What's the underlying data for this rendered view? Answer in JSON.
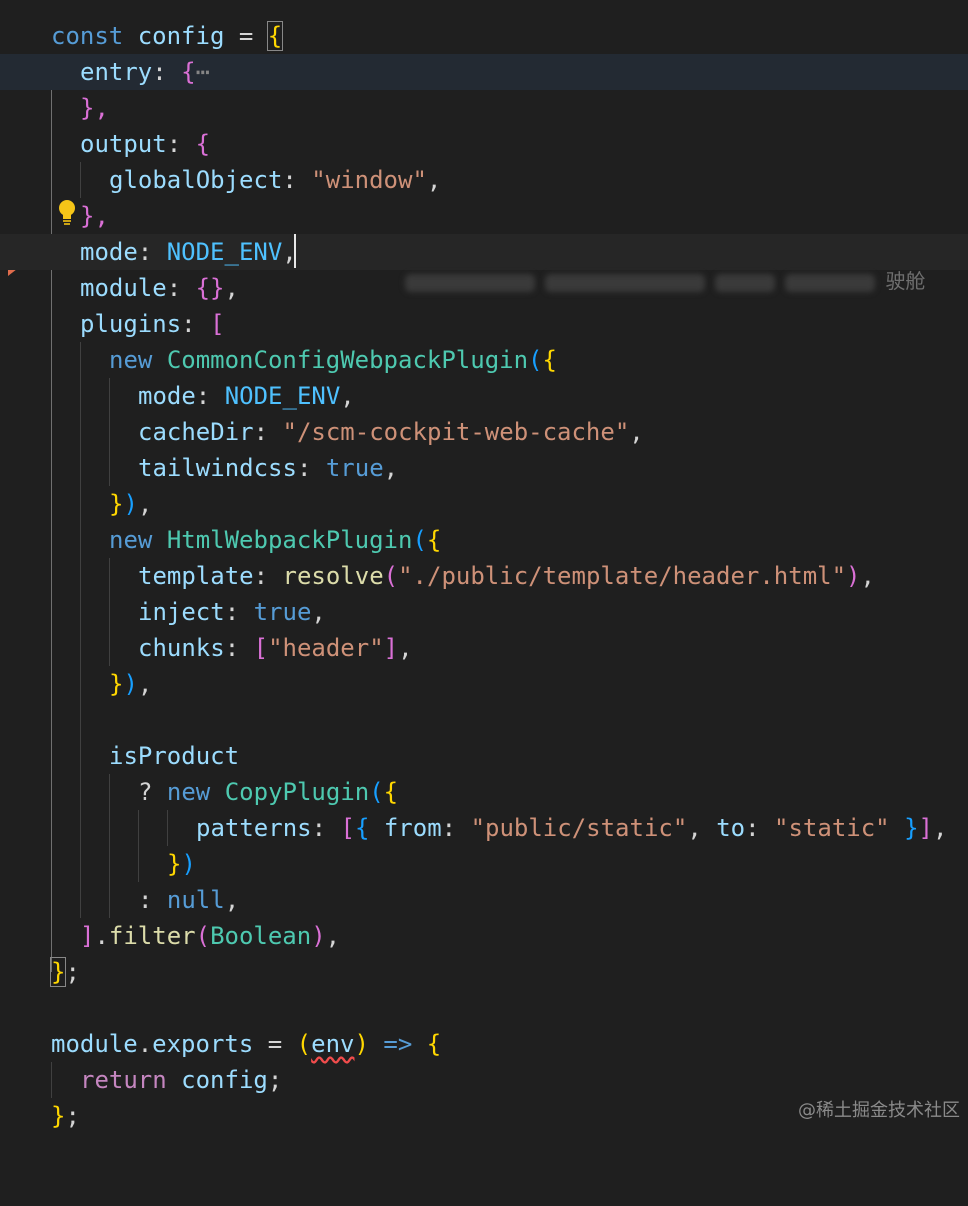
{
  "editor": {
    "lines": {
      "l1": {
        "kw": "const",
        "var": "config",
        "op": "=",
        "brace": "{"
      },
      "l2": {
        "key": "entry",
        "colon": ":",
        "brace": "{",
        "fold": "⋯"
      },
      "l3": {
        "text": "},"
      },
      "l4": {
        "key": "output",
        "colon": ":",
        "brace": "{"
      },
      "l5": {
        "key": "globalObject",
        "colon": ":",
        "str": "\"window\"",
        "comma": ","
      },
      "l6": {
        "text": "},"
      },
      "l7": {
        "key": "mode",
        "colon": ":",
        "const": "NODE_ENV",
        "comma": ","
      },
      "l8": {
        "key": "module",
        "colon": ":",
        "braces": "{}",
        "comma": ","
      },
      "l9": {
        "key": "plugins",
        "colon": ":",
        "bracket": "["
      },
      "l10": {
        "kw": "new",
        "cls": "CommonConfigWebpackPlugin",
        "paren": "(",
        "brace": "{"
      },
      "l11": {
        "key": "mode",
        "colon": ":",
        "const": "NODE_ENV",
        "comma": ","
      },
      "l12": {
        "key": "cacheDir",
        "colon": ":",
        "str": "\"/scm-cockpit-web-cache\"",
        "comma": ","
      },
      "l13": {
        "key": "tailwindcss",
        "colon": ":",
        "bool": "true",
        "comma": ","
      },
      "l14": {
        "brace": "}",
        "paren": ")",
        "comma": ","
      },
      "l15": {
        "kw": "new",
        "cls": "HtmlWebpackPlugin",
        "paren": "(",
        "brace": "{"
      },
      "l16": {
        "key": "template",
        "colon": ":",
        "fn": "resolve",
        "paren_open": "(",
        "str": "\"./public/template/header.html\"",
        "paren_close": ")",
        "comma": ","
      },
      "l17": {
        "key": "inject",
        "colon": ":",
        "bool": "true",
        "comma": ","
      },
      "l18": {
        "key": "chunks",
        "colon": ":",
        "bracket_open": "[",
        "str": "\"header\"",
        "bracket_close": "]",
        "comma": ","
      },
      "l19": {
        "brace": "}",
        "paren": ")",
        "comma": ","
      },
      "l21": {
        "var": "isProduct"
      },
      "l22": {
        "q": "?",
        "kw": "new",
        "cls": "CopyPlugin",
        "paren": "(",
        "brace": "{"
      },
      "l23": {
        "key": "patterns",
        "colon": ":",
        "bracket_open": "[",
        "brace_open": "{",
        "key2": "from",
        "colon2": ":",
        "str": "\"public/static\"",
        "comma": ",",
        "key3": "to",
        "colon3": ":",
        "str2": "\"static\"",
        "brace_close": "}",
        "bracket_close": "]",
        "comma2": ","
      },
      "l24": {
        "brace": "}",
        "paren": ")"
      },
      "l25": {
        "colon": ":",
        "kw": "null",
        "comma": ","
      },
      "l26": {
        "bracket": "]",
        "dot": ".",
        "fn": "filter",
        "paren_open": "(",
        "cls": "Boolean",
        "paren_close": ")",
        "comma": ","
      },
      "l27": {
        "brace": "}",
        "semi": ";"
      },
      "l29": {
        "var": "module",
        "dot": ".",
        "prop": "exports",
        "op": "=",
        "paren_open": "(",
        "param": "env",
        "paren_close": ")",
        "arrow": "=>",
        "brace": "{"
      },
      "l30": {
        "kw": "return",
        "var": "config",
        "semi": ";"
      },
      "l31": {
        "brace": "}",
        "semi": ";"
      }
    },
    "blame_suffix": "驶舱"
  },
  "icons": {
    "fold_chevron": "chevron-right-icon",
    "lightbulb": "lightbulb-icon",
    "debug_arrow": "breakpoint-arrow-icon"
  },
  "colors": {
    "background": "#1f1f1f",
    "keyword": "#569cd6",
    "string": "#ce9178",
    "type": "#4ec9b0",
    "function": "#dcdcaa",
    "variable": "#9cdcfe",
    "bracket_yellow": "#ffd700",
    "bracket_purple": "#da70d6",
    "bracket_blue": "#179fff"
  },
  "watermark": "@稀土掘金技术社区"
}
